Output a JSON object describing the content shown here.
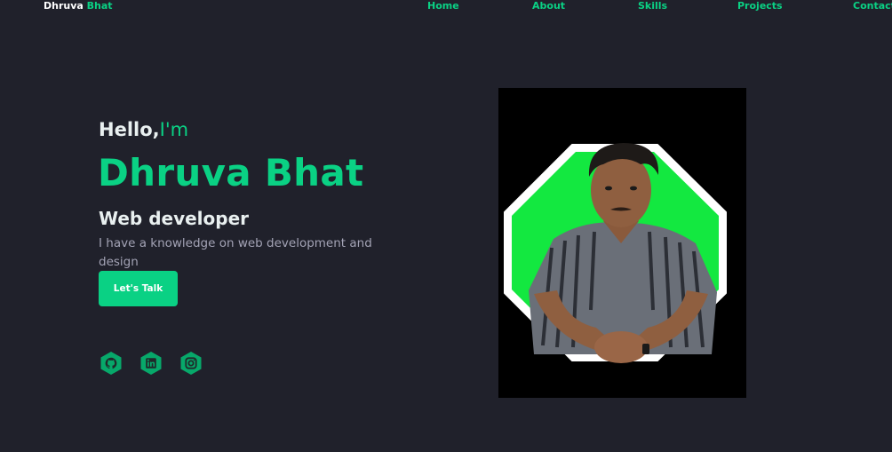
{
  "nav": {
    "brand_first": "Dhruva",
    "brand_last": "Bhat",
    "links": [
      "Home",
      "About",
      "Skills",
      "Projects",
      "Contact"
    ]
  },
  "hero": {
    "greeting": "Hello,",
    "greeting_accent": "I'm",
    "name": "Dhruva Bhat",
    "role": "Web developer",
    "description": "I have a knowledge on web development and design",
    "cta_label": "Let's Talk"
  },
  "social": [
    "github-icon",
    "linkedin-icon",
    "instagram-icon"
  ],
  "colors": {
    "background": "#20212b",
    "accent": "#0ad184",
    "heading": "#e9f0f0",
    "muted": "#a3a3b5",
    "photo_bg": "#000000",
    "octagon": "#13e840"
  }
}
